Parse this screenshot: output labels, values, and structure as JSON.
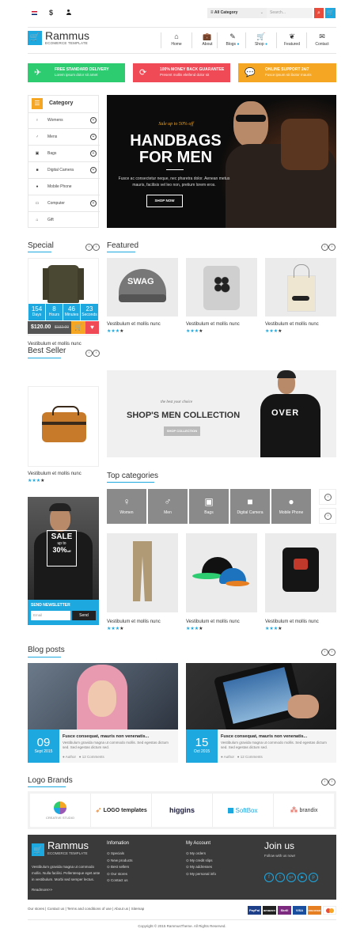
{
  "topbar": {
    "currency": "$",
    "category_select": "All Category",
    "search_placeholder": "Search..."
  },
  "header": {
    "logo_title": "Rammus",
    "logo_sub": "ECOMERCE TEMPLATE",
    "nav": [
      {
        "label": "Home",
        "icon": "home-icon"
      },
      {
        "label": "About",
        "icon": "briefcase-icon"
      },
      {
        "label": "Blogs",
        "icon": "edit-icon"
      },
      {
        "label": "Shop",
        "icon": "cart-icon"
      },
      {
        "label": "Featured",
        "icon": "leaf-icon"
      },
      {
        "label": "Contact",
        "icon": "envelope-icon"
      }
    ]
  },
  "banners": [
    {
      "title": "FREE STANDARD DELIVERY",
      "sub": "Lorem ipsum dolor sit amet",
      "color": "#2ecc71"
    },
    {
      "title": "100% MONEY BACK GUARANTEE",
      "sub": "Present mollis eleifend dolor sit",
      "color": "#ef4a55"
    },
    {
      "title": "ONLINE SUPPORT 24/7",
      "sub": "Fusce ipsum sit ibotor mauris",
      "color": "#f5a623"
    }
  ],
  "category": {
    "title": "Category",
    "items": [
      "Womens",
      "Mens",
      "Bags",
      "Digital Camera",
      "Mobile Phone",
      "Computer",
      "Gift"
    ]
  },
  "hero": {
    "tag": "Sale up to 50% off",
    "title_1": "HANDBAGS",
    "title_2": "FOR MEN",
    "desc": "Fusce ac consectetur neque, nec pharetra dolor. Aenean metus mauris, facilisis vel leo non, pretium lorem eros.",
    "button": "SHOP NOW"
  },
  "special": {
    "title": "Special",
    "countdown": [
      {
        "value": "154",
        "unit": "Days"
      },
      {
        "value": "8",
        "unit": "Hours"
      },
      {
        "value": "46",
        "unit": "Minutes"
      },
      {
        "value": "23",
        "unit": "Seconds"
      }
    ],
    "price": "$120.00",
    "old_price": "$132.00",
    "name": "Vestibulum et mollis nunc"
  },
  "featured": {
    "title": "Featured",
    "products": [
      {
        "name": "Vestibulum et mollis nunc",
        "rating": 3
      },
      {
        "name": "Vestibulum et mollis nunc",
        "rating": 3
      },
      {
        "name": "Vestibulum et mollis nunc",
        "rating": 3
      }
    ]
  },
  "bestseller": {
    "title": "Best Seller",
    "name": "Vestibulum et mollis nunc",
    "rating": 3
  },
  "collection": {
    "tag": "the best your choice",
    "title": "SHOP'S MEN COLLECTION",
    "button": "SHOP COLLECTION",
    "shirt_text": "OVER"
  },
  "top_categories": {
    "title": "Top categories",
    "items": [
      "Women",
      "Men",
      "Bags",
      "Digital Camera",
      "Mobile Phone"
    ],
    "products": [
      {
        "name": "Vestibulum et mollis nunc",
        "rating": 3
      },
      {
        "name": "Vestibulum et mollis nunc",
        "rating": 3
      },
      {
        "name": "Vestibulum et mollis nunc",
        "rating": 3
      }
    ]
  },
  "sale_banner": {
    "line1": "SALE",
    "line2": "up to",
    "line3": "30%",
    "line4": "off"
  },
  "newsletter": {
    "title": "SEND NEWSLETTER",
    "placeholder": "Email",
    "button": "Send"
  },
  "blog": {
    "title": "Blog posts",
    "posts": [
      {
        "day": "09",
        "month": "Sept 2015",
        "title": "Fusce consequat, mauris non venenatis...",
        "excerpt": "Vestibulum gravida magna ut commodo mollis. Sed egestas dictum sed. Sed egestas dictum sed.",
        "author": "Author",
        "comments": "12 Comments"
      },
      {
        "day": "15",
        "month": "Oct 2015",
        "title": "Fusce consequat, mauris non venenatis...",
        "excerpt": "Vestibulum gravida magna ut commodo mollis. Sed egestas dictum sed. Sed egestas dictum sed.",
        "author": "Author",
        "comments": "12 Comments"
      }
    ]
  },
  "brands": {
    "title": "Logo Brands",
    "items": [
      "CREATIVE STUDIO",
      "LOGO templates",
      "higgins",
      "SoftBox",
      "brandix"
    ]
  },
  "footer": {
    "logo_title": "Rammus",
    "logo_sub": "ECOMERCE TEMPLATE",
    "about": "Vestibulum gravida magna ut commodo mollis. Nulla facilisi. Pellentesque eget ante in vestibulum. Morbi sed semper lectus.",
    "readmore": "Readmore>>",
    "info_title": "Infomation",
    "info_links": [
      "Specials",
      "New products",
      "Best sellers",
      "Our stores",
      "Contact us"
    ],
    "account_title": "My Account",
    "account_links": [
      "My orders",
      "My credit slips",
      "My addresses",
      "My personal info"
    ],
    "join_title": "Join us",
    "join_sub": "Follow with us now!",
    "bottom_links": [
      "Our stores",
      "Contact us",
      "Terms and conditions of use",
      "About us",
      "Sitemap"
    ],
    "payments": [
      "PayPal",
      "amazon",
      "Skrill",
      "VISA",
      "DISCOVER",
      "MC"
    ],
    "copyright": "Copyright © 2015 RammusTheme. All Rights Reserved."
  }
}
